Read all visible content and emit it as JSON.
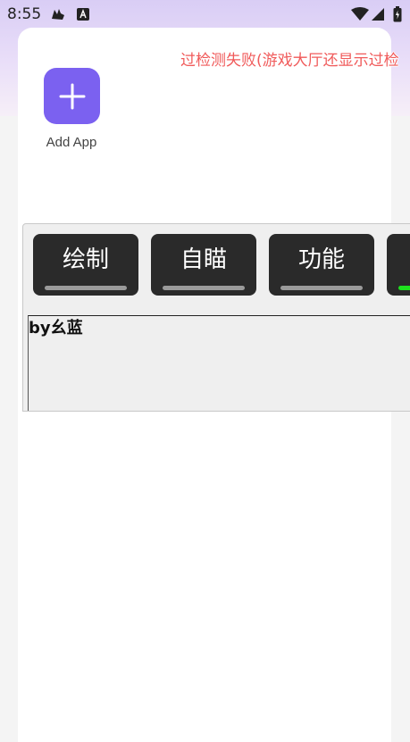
{
  "status_bar": {
    "time": "8:55",
    "left_icons": [
      "bird-icon",
      "a-box-icon"
    ],
    "right_icons": [
      "wifi-icon",
      "signal-icon",
      "battery-icon"
    ]
  },
  "banner": {
    "text": "过检测失败(游戏大厅还显示过检"
  },
  "launcher": {
    "add_app_label": "Add App",
    "add_icon": "plus-icon"
  },
  "menu": {
    "tabs": [
      {
        "label": "绘制",
        "active": false
      },
      {
        "label": "自瞄",
        "active": false
      },
      {
        "label": "功能",
        "active": false
      },
      {
        "label": "",
        "active": true
      }
    ],
    "author": "by幺蓝"
  },
  "colors": {
    "accent": "#7b61f0",
    "banner_text": "#f05a5a",
    "tab_bg": "#2a2a2a",
    "tab_indicator": "#9a9a9a",
    "tab_indicator_active": "#1ee01e"
  }
}
